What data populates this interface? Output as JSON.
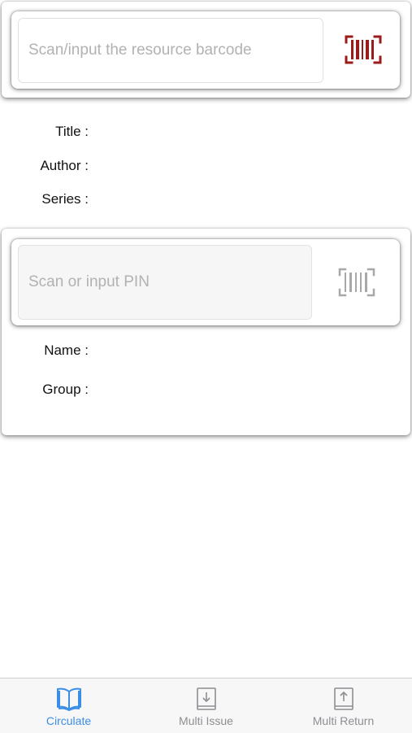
{
  "resource_scan": {
    "placeholder": "Scan/input the resource barcode",
    "value": "",
    "icon": "barcode-icon",
    "icon_color": "#9b1b1b"
  },
  "resource_details": {
    "title_label": "Title :",
    "title_value": "",
    "author_label": "Author :",
    "author_value": "",
    "series_label": "Series :",
    "series_value": ""
  },
  "patron_scan": {
    "placeholder": "Scan or input PIN",
    "value": "",
    "icon": "barcode-icon",
    "icon_color": "#a8a8a8"
  },
  "patron_details": {
    "name_label": "Name :",
    "name_value": "",
    "group_label": "Group :",
    "group_value": ""
  },
  "tabbar": {
    "tabs": [
      {
        "label": "Circulate",
        "icon": "book-icon",
        "active": true
      },
      {
        "label": "Multi Issue",
        "icon": "download-icon",
        "active": false
      },
      {
        "label": "Multi Return",
        "icon": "upload-icon",
        "active": false
      }
    ],
    "active_color": "#3a8ee6",
    "inactive_color": "#8e8e93"
  }
}
